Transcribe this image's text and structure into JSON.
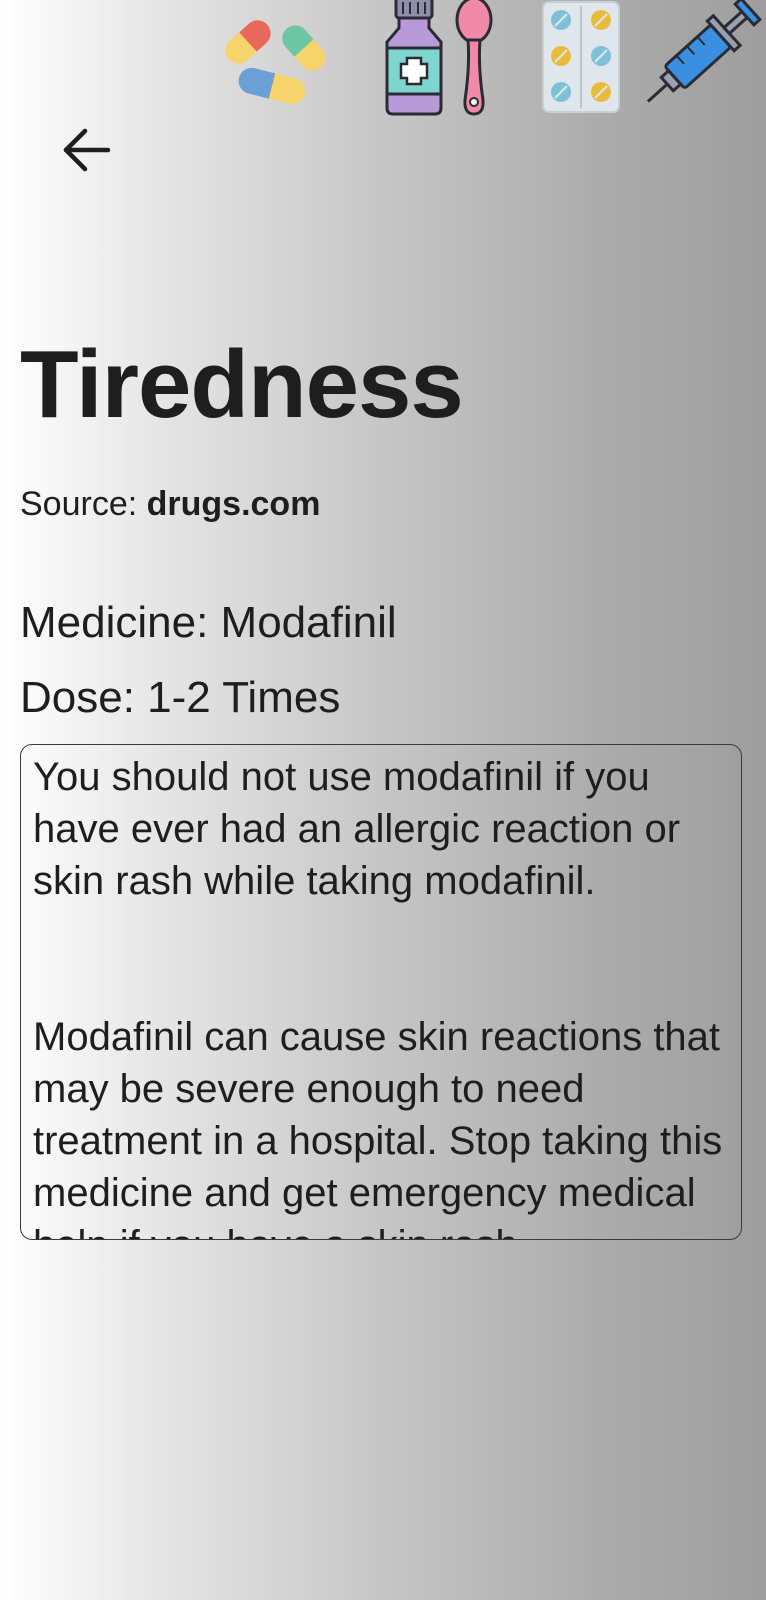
{
  "header": {
    "icons": [
      "pills-icon",
      "medicine-bottle-icon",
      "spoon-icon",
      "pill-blister-pack-icon",
      "syringe-icon"
    ],
    "back_icon": "arrow-left-icon"
  },
  "main": {
    "title": "Tiredness",
    "source_label": "Source: ",
    "source_value": "drugs.com",
    "medicine_text": "Medicine: Modafinil",
    "dose_text": "Dose: 1-2 Times",
    "description": "You should not use modafinil if you have ever had an allergic reaction or skin rash while taking modafinil.\n\n\nModafinil can cause skin reactions that may be severe enough to need treatment in a hospital. Stop taking this medicine and get emergency medical help if you have a skin rash"
  },
  "colors": {
    "text": "#1e1e1e",
    "gradient_start": "#ffffff",
    "gradient_end": "#9e9e9e"
  }
}
